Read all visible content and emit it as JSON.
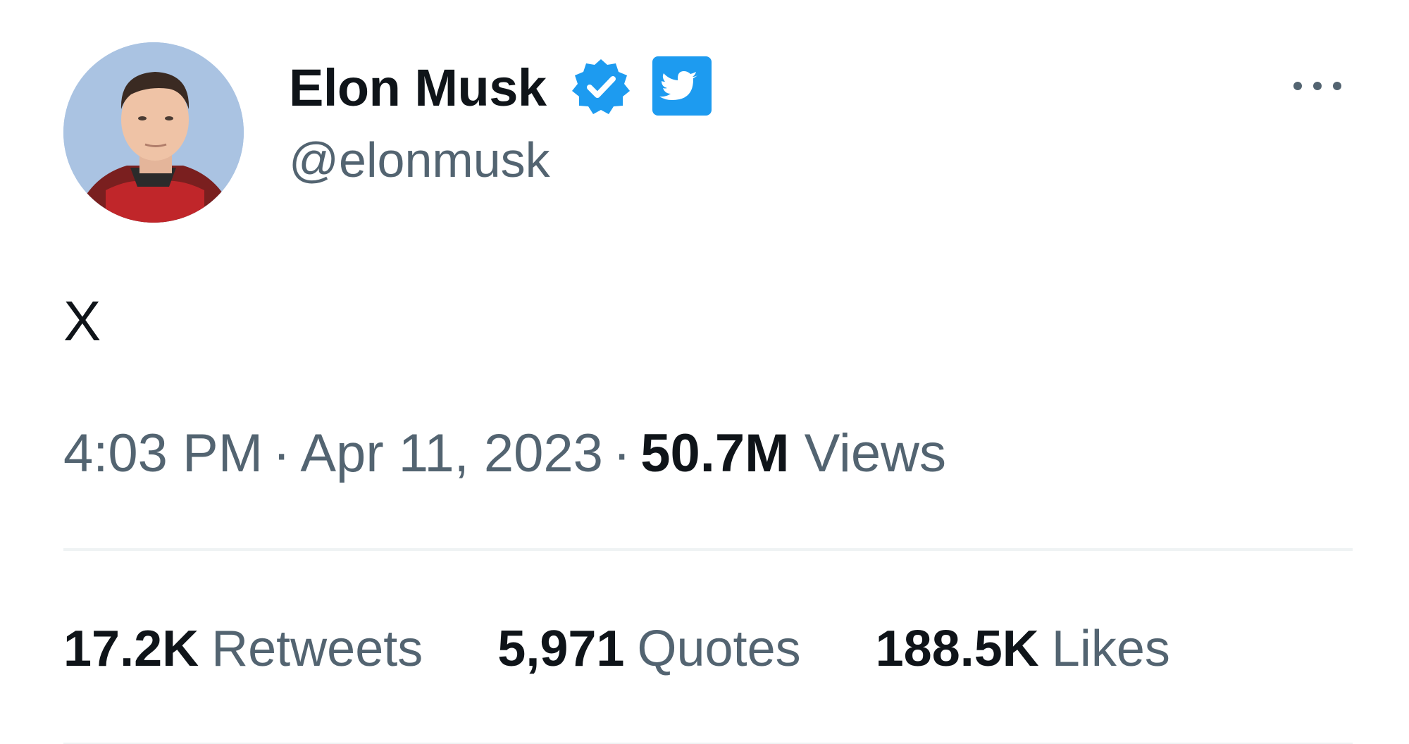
{
  "author": {
    "display_name": "Elon Musk",
    "handle": "@elonmusk",
    "verified_icon": "verified-badge-icon",
    "affiliate_icon": "twitter-bird-icon",
    "avatar_icon": "avatar-photo"
  },
  "tweet": {
    "text": "X"
  },
  "meta": {
    "time": "4:03 PM",
    "separator": "·",
    "date": "Apr 11, 2023",
    "views_count": "50.7M",
    "views_label": "Views"
  },
  "stats": [
    {
      "count": "17.2K",
      "label": "Retweets"
    },
    {
      "count": "5,971",
      "label": "Quotes"
    },
    {
      "count": "188.5K",
      "label": "Likes"
    }
  ],
  "more_icon": "more-options-icon",
  "colors": {
    "primary_text": "#0f1419",
    "secondary_text": "#536471",
    "accent_blue": "#1d9bf0",
    "divider": "#eff3f4"
  }
}
